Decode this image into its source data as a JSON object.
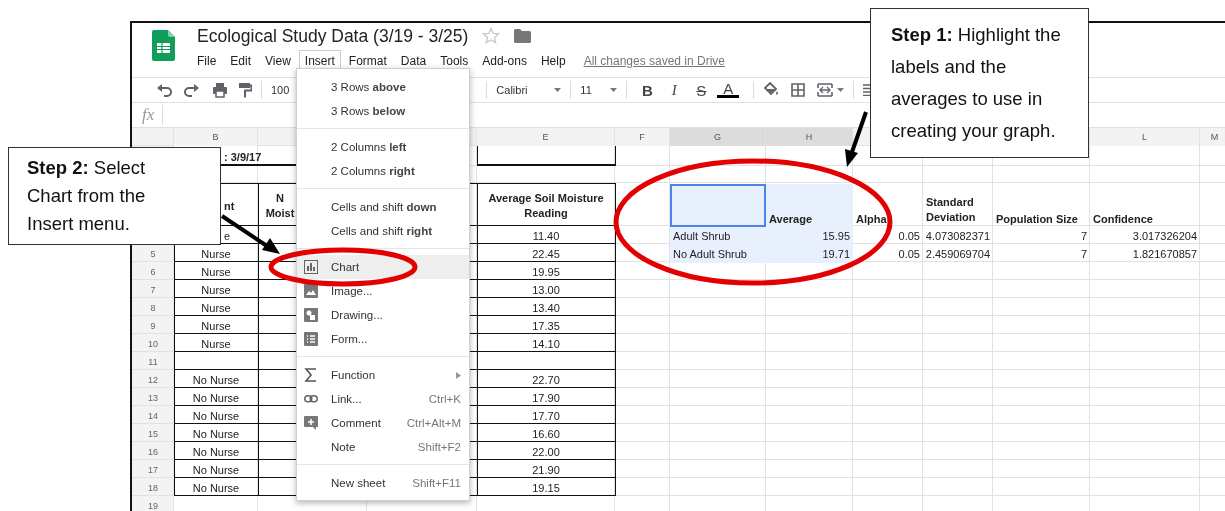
{
  "doc": {
    "title": "Ecological Study Data (3/19 - 3/25)",
    "starred": false
  },
  "menubar": [
    {
      "label": "File",
      "selected": false
    },
    {
      "label": "Edit",
      "selected": false
    },
    {
      "label": "View",
      "selected": false
    },
    {
      "label": "Insert",
      "selected": true
    },
    {
      "label": "Format",
      "selected": false
    },
    {
      "label": "Data",
      "selected": false
    },
    {
      "label": "Tools",
      "selected": false
    },
    {
      "label": "Add-ons",
      "selected": false
    },
    {
      "label": "Help",
      "selected": false
    }
  ],
  "save_status": "All changes saved in Drive",
  "toolbar": {
    "zoom": "100",
    "font": "Calibri",
    "font_size": "11",
    "format_buttons": [
      {
        "kind": "bold",
        "label": "B"
      },
      {
        "kind": "italic",
        "label": "I"
      },
      {
        "kind": "strike",
        "label": "S"
      },
      {
        "kind": "color",
        "label": "A"
      }
    ]
  },
  "formula_bar": {
    "label": "fx"
  },
  "grid": {
    "columns": [
      "B",
      null,
      null,
      "E",
      "F",
      "G",
      "H",
      null,
      null,
      null,
      "L",
      "M"
    ],
    "rows": [
      {
        "kind": "title",
        "cells": [
          ": 3/9/17"
        ]
      },
      {
        "kind": "gap"
      },
      {
        "kind": "header",
        "cells": [
          "nt",
          "N Moist",
          null,
          "Average Soil Moisture Reading",
          null,
          {
            "selected": true,
            "active": true
          },
          {
            "text": "Average",
            "selected": true,
            "active": false
          },
          "Alpha",
          "Standard Deviation",
          "Population Size",
          "Confidence"
        ]
      },
      {
        "kind": "data",
        "cells": [
          "e",
          null,
          null,
          "11.40",
          null,
          {
            "text": "Adult Shrub",
            "selected": true,
            "active": false
          },
          {
            "text": "15.95",
            "selected": true,
            "active": false
          },
          "0.05",
          "4.073082371",
          "7",
          "3.017326204"
        ]
      },
      {
        "kind": "data",
        "number": "5",
        "cells": [
          "Nurse",
          null,
          null,
          "22.45",
          null,
          {
            "text": "No Adult Shrub",
            "selected": true,
            "active": false
          },
          {
            "text": "19.71",
            "selected": true,
            "active": false
          },
          "0.05",
          "2.459069704",
          "7",
          "1.821670857"
        ]
      },
      {
        "kind": "data",
        "number": "6",
        "cells": [
          "Nurse",
          null,
          null,
          "19.95"
        ]
      },
      {
        "kind": "data",
        "number": "7",
        "cells": [
          "Nurse",
          null,
          null,
          "13.00"
        ]
      },
      {
        "kind": "data",
        "number": "8",
        "cells": [
          "Nurse",
          null,
          null,
          "13.40"
        ]
      },
      {
        "kind": "data",
        "number": "9",
        "cells": [
          "Nurse",
          null,
          null,
          "17.35"
        ]
      },
      {
        "kind": "data",
        "number": "10",
        "cells": [
          "Nurse",
          null,
          null,
          "14.10"
        ]
      },
      {
        "kind": "data",
        "number": "11"
      },
      {
        "kind": "data",
        "number": "12",
        "cells": [
          "No Nurse",
          null,
          null,
          "22.70"
        ]
      },
      {
        "kind": "data",
        "number": "13",
        "cells": [
          "No Nurse",
          null,
          null,
          "17.90"
        ]
      },
      {
        "kind": "data",
        "number": "14",
        "cells": [
          "No Nurse",
          null,
          null,
          "17.70"
        ]
      },
      {
        "kind": "data",
        "number": "15",
        "cells": [
          "No Nurse",
          null,
          null,
          "16.60"
        ]
      },
      {
        "kind": "data",
        "number": "16",
        "cells": [
          "No Nurse",
          null,
          null,
          "22.00"
        ]
      },
      {
        "kind": "data",
        "number": "17",
        "cells": [
          "No Nurse",
          null,
          null,
          "21.90"
        ]
      },
      {
        "kind": "data",
        "number": "18",
        "cells": [
          "No Nurse",
          null,
          null,
          "19.15"
        ]
      },
      {
        "kind": "gap",
        "number": "19"
      }
    ]
  },
  "insert_menu": {
    "groups": [
      [
        {
          "label": "3 Rows **above**",
          "selected": false
        },
        {
          "label": "3 Rows **below**",
          "selected": false
        }
      ],
      [
        {
          "label": "2 Columns **left**",
          "selected": false
        },
        {
          "label": "2 Columns **right**",
          "selected": false
        }
      ],
      [
        {
          "label": "Cells and shift **down**",
          "selected": false
        },
        {
          "label": "Cells and shift **right**",
          "selected": false
        }
      ],
      [
        {
          "label": "Chart",
          "selected": true
        },
        {
          "label": "Image...",
          "selected": false
        },
        {
          "label": "Drawing...",
          "selected": false
        },
        {
          "label": "Form...",
          "selected": false
        }
      ],
      [
        {
          "label": "Function",
          "selected": false,
          "submenu": true
        },
        {
          "label": "Link...",
          "shortcut": "Ctrl+K",
          "selected": false
        },
        {
          "label": "Comment",
          "shortcut": "Ctrl+Alt+M",
          "selected": false
        },
        {
          "label": "Note",
          "shortcut": "Shift+F2",
          "selected": false
        }
      ],
      [
        {
          "label": "New sheet",
          "shortcut": "Shift+F11",
          "selected": false
        }
      ]
    ]
  },
  "callouts": [
    {
      "text": "**Step 1:** Highlight the labels and the averages to use in creating your graph."
    },
    {
      "text": "**Step 2:** Select Chart from the Insert menu."
    }
  ]
}
